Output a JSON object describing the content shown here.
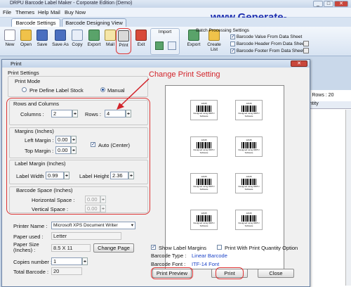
{
  "app": {
    "title": "DRPU Barcode Label Maker - Corporate Edition (Demo)",
    "menu": [
      "File",
      "Themes",
      "Help",
      "Mail",
      "Buy Now"
    ],
    "brand": "www.Generate-Barcode.com",
    "tabs": [
      "Barcode Settings",
      "Barcode Designing View"
    ],
    "toolbar": [
      "New",
      "Open",
      "Save",
      "Save As",
      "Copy",
      "Export",
      "Mail",
      "Print",
      "Exit"
    ],
    "import_group": "Import",
    "import_buttons": [
      "Export",
      "Create List"
    ],
    "batch_title": "Batch Processing Settings",
    "batch_options": [
      {
        "label": "Barcode Value From Data Sheet",
        "checked": true
      },
      {
        "label": "Barcode Header From Data Sheet",
        "checked": false
      },
      {
        "label": "Barcode Footer From Data Sheet",
        "checked": true
      }
    ],
    "right_panel": {
      "total_rows": "tal Rows : 20",
      "col": "antity"
    }
  },
  "dialog": {
    "title": "Print",
    "section": "Print Settings",
    "mode_label": "Print Mode",
    "mode_options": [
      "Pre Define Label Stock",
      "Manual"
    ],
    "rows_cols_label": "Rows and Columns",
    "columns_label": "Columns :",
    "columns_value": "2",
    "rows_label": "Rows :",
    "rows_value": "4",
    "margins_label": "Margins (Inches)",
    "left_margin_label": "Left Margin :",
    "left_margin_value": "0.00",
    "top_margin_label": "Top Margin :",
    "top_margin_value": "0.00",
    "auto_center": "Auto (Center)",
    "label_margin_label": "Label Margin (Inches)",
    "label_width_label": "Label Width :",
    "label_width_value": "0.99",
    "label_height_label": "Label Height :",
    "label_height_value": "2.36",
    "barcode_space_label": "Barcode Space (Inches)",
    "hspace_label": "Horizontal Space :",
    "hspace_value": "0.00",
    "vspace_label": "Vertical Space :",
    "vspace_value": "0.00",
    "printer_name_label": "Printer Name :",
    "printer_name_value": "Microsoft XPS Document Writer",
    "paper_used_label": "Paper used :",
    "paper_used_value": "Letter",
    "paper_size_label": "Paper Size\n(Inches) :",
    "paper_size_value": "8.5 X 11",
    "change_page": "Change Page",
    "copies_label": "Copies number :",
    "copies_value": "1",
    "total_barcode_label": "Total Barcode :",
    "total_barcode_value": "20",
    "show_label_margins": "Show Label Margins",
    "print_with_qty": "Print With Print Quantity Option",
    "barcode_type_label": "Barcode Type :",
    "barcode_type_value": "Linear Barcode",
    "barcode_font_label": "Barcode Font :",
    "barcode_font_value": "ITF-14 Font",
    "btn_preview": "Print Preview",
    "btn_print": "Print",
    "btn_close": "Close",
    "callout": "Change Print Setting",
    "accent": "#d2232a",
    "link_color": "#1d44c8"
  },
  "preview_label": {
    "header": "12345",
    "footer": "Designed using DRPU Software"
  }
}
